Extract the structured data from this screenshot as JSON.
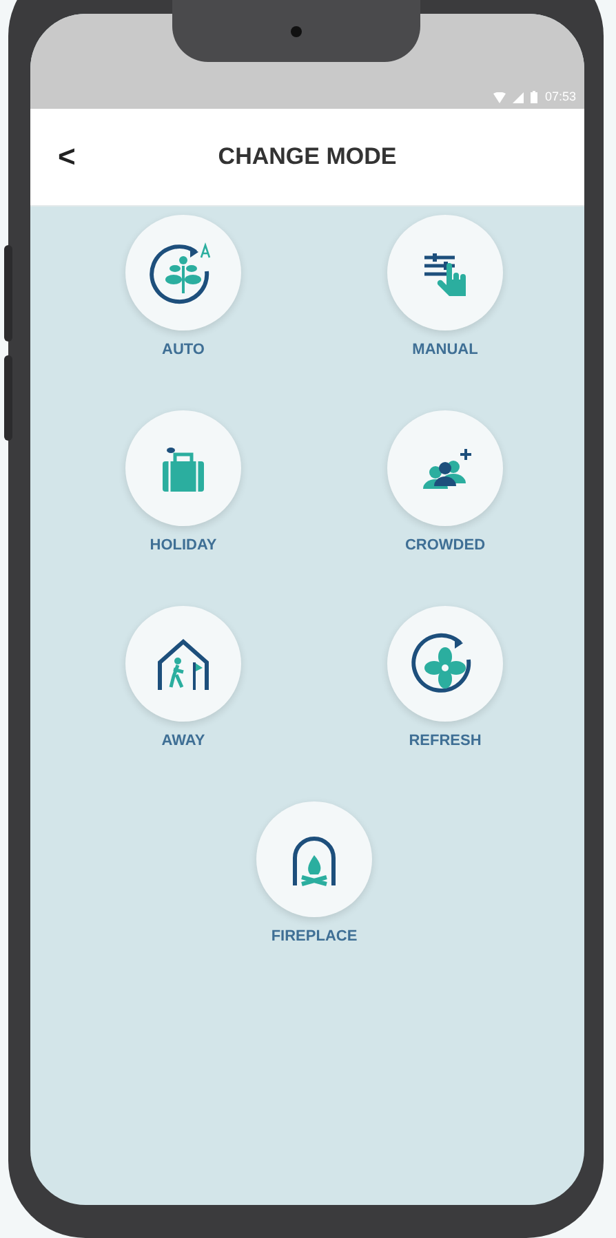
{
  "status_bar": {
    "time": "07:53"
  },
  "header": {
    "back": "<",
    "title": "CHANGE MODE"
  },
  "modes": [
    {
      "kind": "auto",
      "label": "AUTO"
    },
    {
      "kind": "manual",
      "label": "MANUAL"
    },
    {
      "kind": "holiday",
      "label": "HOLIDAY"
    },
    {
      "kind": "crowded",
      "label": "CROWDED"
    },
    {
      "kind": "away",
      "label": "AWAY"
    },
    {
      "kind": "refresh",
      "label": "REFRESH"
    },
    {
      "kind": "fireplace",
      "label": "FIREPLACE"
    }
  ]
}
